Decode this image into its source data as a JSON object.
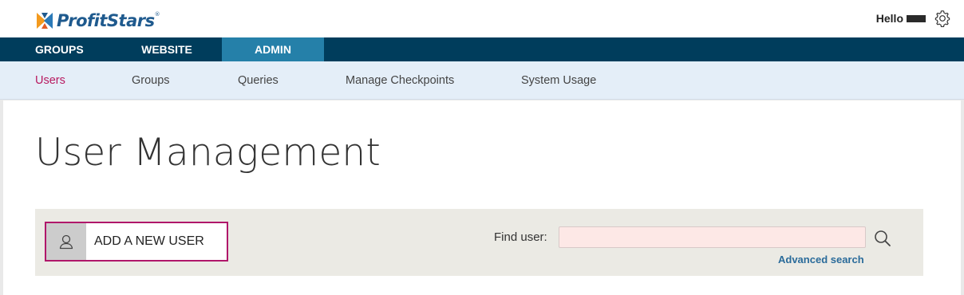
{
  "header": {
    "brand": "ProfitStars",
    "brand_mark": "®",
    "greeting": "Hello",
    "settings_icon": "gear-icon"
  },
  "main_nav": {
    "tabs": [
      {
        "label": "GROUPS",
        "active": false
      },
      {
        "label": "WEBSITE",
        "active": false
      },
      {
        "label": "ADMIN",
        "active": true
      }
    ]
  },
  "sub_nav": {
    "items": [
      {
        "label": "Users",
        "active": true
      },
      {
        "label": "Groups",
        "active": false
      },
      {
        "label": "Queries",
        "active": false
      },
      {
        "label": "Manage Checkpoints",
        "active": false
      },
      {
        "label": "System Usage",
        "active": false
      }
    ]
  },
  "page": {
    "title": "User Management"
  },
  "toolbar": {
    "add_user_label": "ADD A NEW USER",
    "add_user_icon": "user-icon",
    "find_user_label": "Find user:",
    "find_user_value": "",
    "search_icon": "search-icon",
    "advanced_search_label": "Advanced search"
  },
  "colors": {
    "nav_bg": "#003d5c",
    "active_tab_bg": "#2580a9",
    "accent": "#b8195f",
    "subnav_bg": "#e4eef8",
    "link": "#2a6b9a"
  }
}
